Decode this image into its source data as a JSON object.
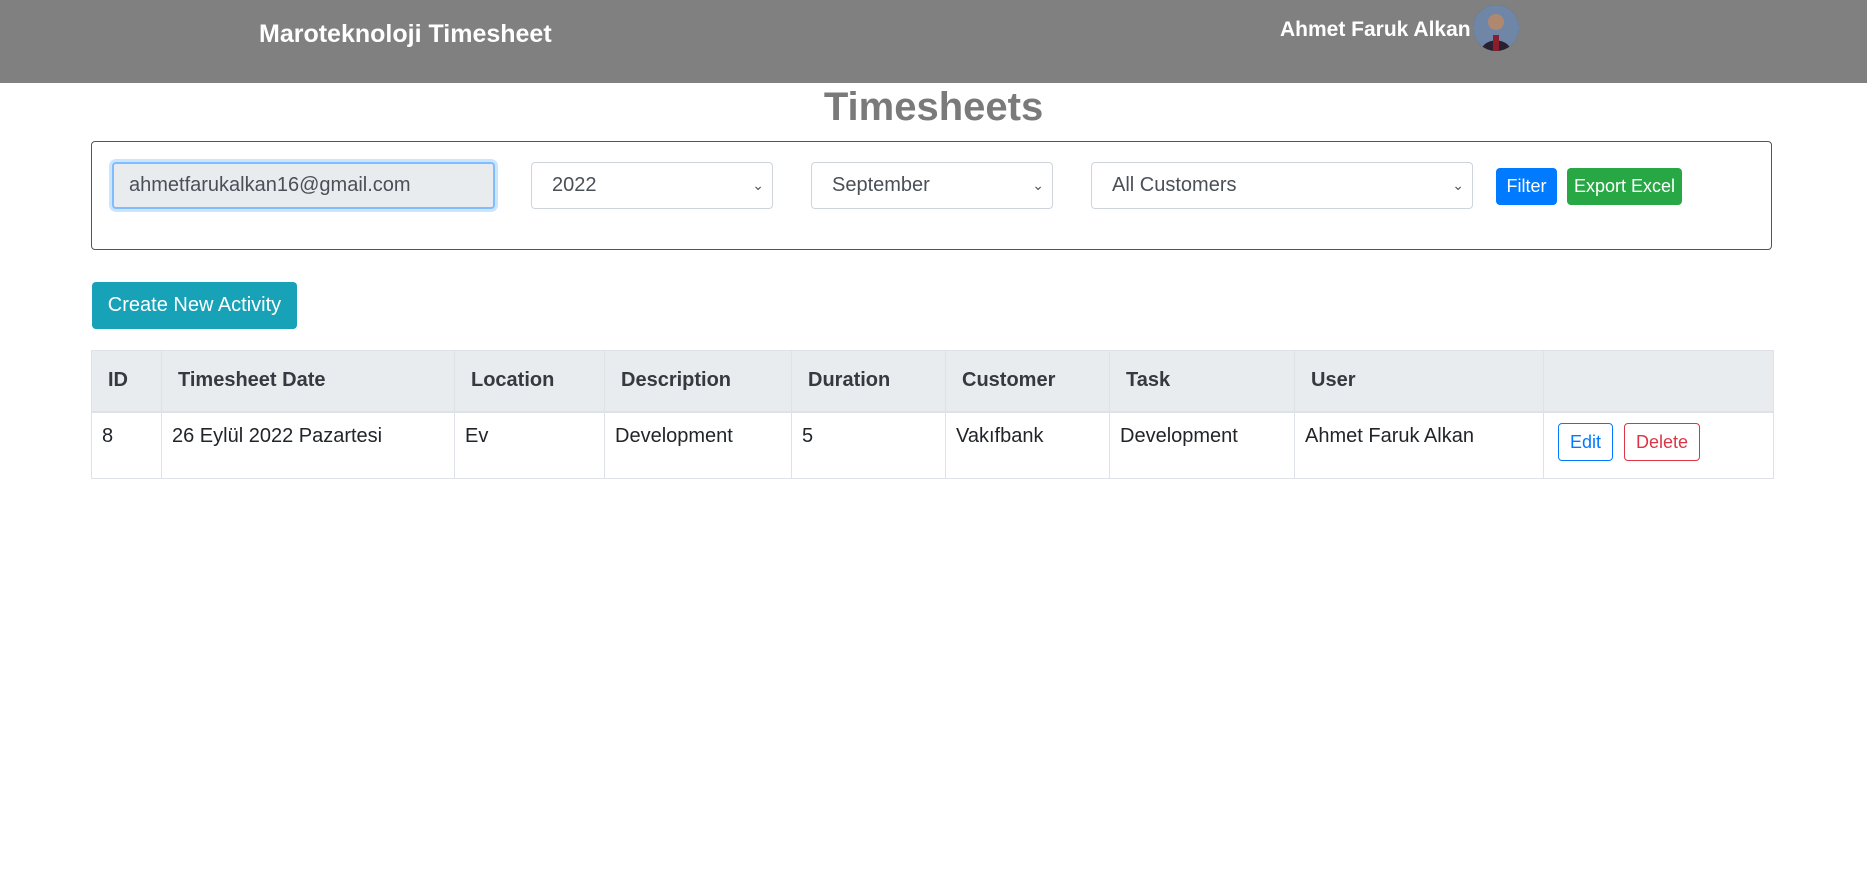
{
  "header": {
    "brand": "Maroteknoloji Timesheet",
    "user_name": "Ahmet Faruk Alkan",
    "avatar_icon": "user-avatar"
  },
  "page": {
    "title": "Timesheets"
  },
  "filters": {
    "email_value": "ahmetfarukalkan16@gmail.com",
    "year_selected": "2022",
    "month_selected": "September",
    "customer_selected": "All Customers",
    "filter_label": "Filter",
    "export_label": "Export Excel"
  },
  "actions": {
    "create_label": "Create New Activity"
  },
  "table": {
    "columns": [
      "ID",
      "Timesheet Date",
      "Location",
      "Description",
      "Duration",
      "Customer",
      "Task",
      "User",
      ""
    ],
    "rows": [
      {
        "id": "8",
        "date": "26 Eylül 2022 Pazartesi",
        "location": "Ev",
        "description": "Development",
        "duration": "5",
        "customer": "Vakıfbank",
        "task": "Development",
        "user": "Ahmet Faruk Alkan",
        "edit_label": "Edit",
        "delete_label": "Delete"
      }
    ]
  },
  "colors": {
    "header_bg": "#808080",
    "primary": "#007bff",
    "success": "#28a745",
    "info": "#17a2b8",
    "danger": "#dc3545"
  }
}
